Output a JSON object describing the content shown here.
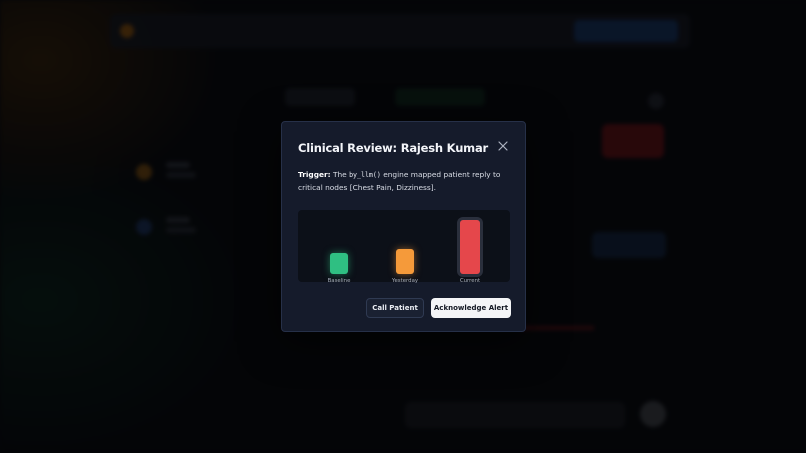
{
  "modal": {
    "title": "Clinical Review: Rajesh Kumar",
    "trigger_label": "Trigger:",
    "trigger_prefix": "The",
    "trigger_code": "by_llm()",
    "trigger_suffix": "engine mapped patient reply to critical nodes [Chest Pain, Dizziness].",
    "close_icon": "close-icon"
  },
  "chart_data": {
    "type": "bar",
    "categories": [
      "Baseline",
      "Yesterday",
      "Current"
    ],
    "values": [
      1,
      1.2,
      2.6
    ],
    "colors": [
      "#2fbf82",
      "#f59a3a",
      "#e5474b"
    ],
    "title": "",
    "xlabel": "",
    "ylabel": ""
  },
  "actions": {
    "call_label": "Call Patient",
    "ack_label": "Acknowledge Alert"
  }
}
